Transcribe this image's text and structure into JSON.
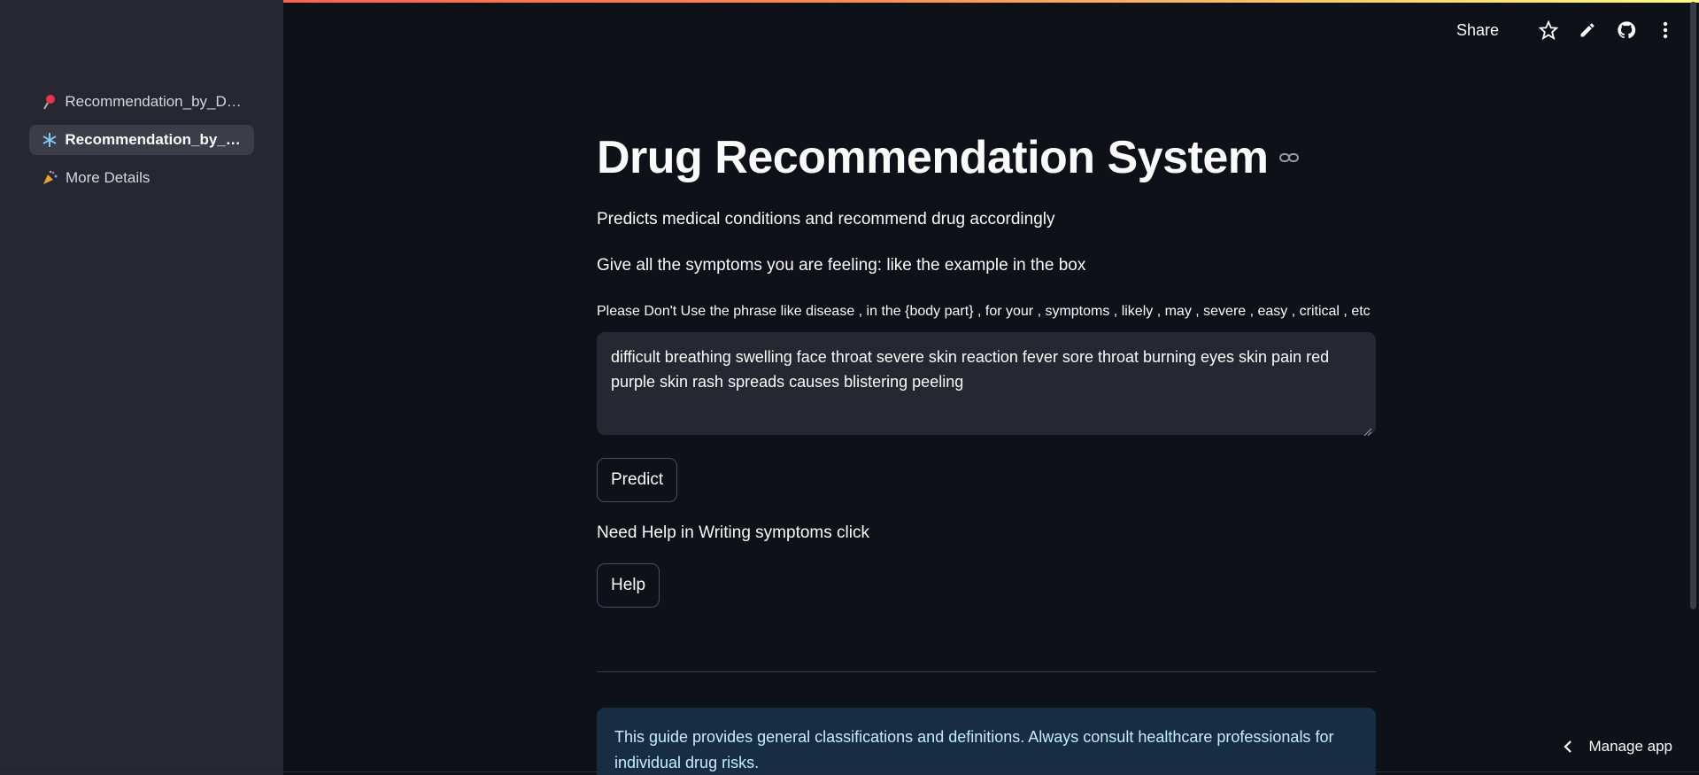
{
  "header": {
    "share_label": "Share"
  },
  "sidebar": {
    "items": [
      {
        "icon": "pushpin-icon",
        "label": "Recommendation_by_Drug",
        "active": false
      },
      {
        "icon": "snowflake-icon",
        "label": "Recommendation_by_S...",
        "active": true
      },
      {
        "icon": "party-popper-icon",
        "label": "More Details",
        "active": false
      }
    ]
  },
  "main": {
    "title": "Drug Recommendation System",
    "subtitle": "Predicts medical conditions and recommend drug accordingly",
    "instruction": "Give all the symptoms you are feeling: like the example in the box",
    "warning": "Please Don't Use the phrase like disease , in the {body part} , for your , symptoms , likely , may , severe , easy , critical , etc",
    "symptoms_value": "difficult breathing swelling face throat severe skin reaction fever sore throat burning eyes skin pain red purple skin rash spreads causes blistering peeling",
    "predict_label": "Predict",
    "help_prompt": "Need Help in Writing symptoms click",
    "help_label": "Help",
    "info_text": "This guide provides general classifications and definitions. Always consult healthcare professionals for individual drug risks."
  },
  "footer": {
    "manage_app_label": "Manage app"
  },
  "colors": {
    "background": "#0e1117",
    "sidebar": "#262730",
    "info_background": "#172d43",
    "info_text": "#c7ebff"
  }
}
